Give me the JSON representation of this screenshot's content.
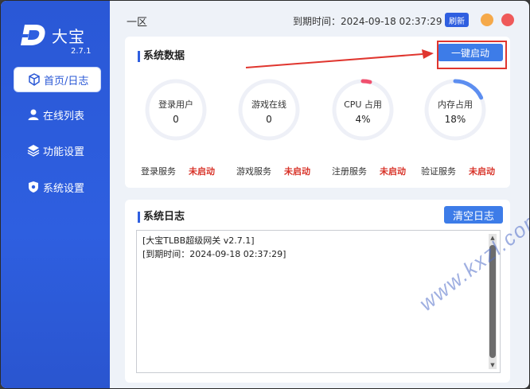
{
  "app": {
    "name": "大宝",
    "version": "2.7.1",
    "zone": "一区",
    "expire_text": "到期时间：2024-09-18 02:37:29",
    "refresh_label": "刷新"
  },
  "sidebar": {
    "items": [
      {
        "label": "首页/日志",
        "icon": "cube-icon",
        "active": true
      },
      {
        "label": "在线列表",
        "icon": "user-icon",
        "active": false
      },
      {
        "label": "功能设置",
        "icon": "layers-icon",
        "active": false
      },
      {
        "label": "系统设置",
        "icon": "shield-gear-icon",
        "active": false
      }
    ]
  },
  "data_panel": {
    "title": "系统数据",
    "start_label": "一键启动",
    "gauges": [
      {
        "label": "登录用户",
        "value": "0",
        "percent": 0
      },
      {
        "label": "游戏在线",
        "value": "0",
        "percent": 0
      },
      {
        "label": "CPU 占用",
        "value": "4%",
        "percent": 4
      },
      {
        "label": "内存占用",
        "value": "18%",
        "percent": 18
      }
    ],
    "services": [
      {
        "name": "登录服务",
        "state": "未启动"
      },
      {
        "name": "游戏服务",
        "state": "未启动"
      },
      {
        "name": "注册服务",
        "state": "未启动"
      },
      {
        "name": "验证服务",
        "state": "未启动"
      }
    ]
  },
  "log_panel": {
    "title": "系统日志",
    "clear_label": "清空日志",
    "lines": [
      "[大宝TLBB超级网关 v2.7.1]",
      "[到期时间：2024-09-18 02:37:29]"
    ]
  },
  "watermark": "www.kxzl.com",
  "colors": {
    "accent": "#2f5fe0",
    "annotation_red": "#e0362f",
    "status_red": "#d8342a",
    "gauge_track": "#eef0f7",
    "gauge_red": "#f0506e",
    "gauge_blue": "#5d8ef0"
  }
}
